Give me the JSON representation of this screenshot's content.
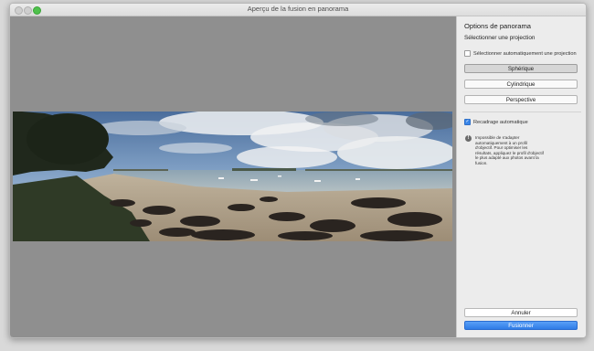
{
  "window": {
    "title": "Aperçu de la fusion en panorama"
  },
  "panel": {
    "title": "Options de panorama",
    "subtitle": "Sélectionner une projection",
    "auto_select_label": "Sélectionner automatiquement une projection",
    "auto_select_checked": false,
    "projections": [
      {
        "label": "Sphérique",
        "selected": true
      },
      {
        "label": "Cylindrique",
        "selected": false
      },
      {
        "label": "Perspective",
        "selected": false
      }
    ],
    "auto_crop_label": "Recadrage automatique",
    "auto_crop_checked": true,
    "warning_text": "Impossible de s'adapter automatiquement à un profil d'objectif. Pour optimiser les résultats, appliquez le profil d'objectif le plus adapté aux photos avant la fusion.",
    "cancel_label": "Annuler",
    "merge_label": "Fusionner"
  },
  "colors": {
    "accent": "#3a86e8",
    "preview_bg": "#8f8f8f"
  },
  "icons": {
    "warning": "exclamation-circle-icon",
    "check": "checkmark-icon"
  }
}
